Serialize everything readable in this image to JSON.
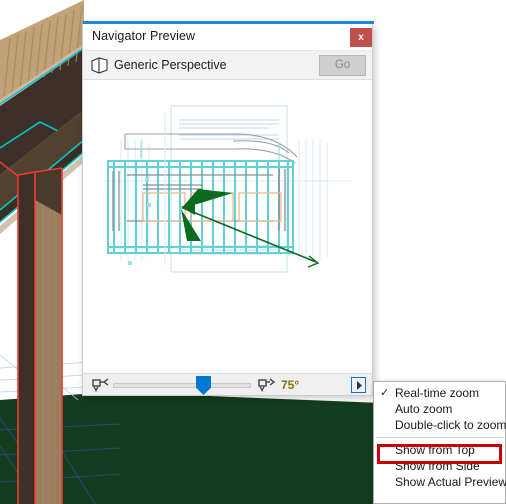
{
  "panel": {
    "title": "Navigator Preview",
    "close_label": "x",
    "close_icon": "close-icon",
    "accent_color": "#1e88d8",
    "close_color": "#c0504b"
  },
  "perspective_row": {
    "icon": "cube-3d-icon",
    "label": "Generic Perspective",
    "go_label": "Go",
    "go_enabled": false
  },
  "toolbar": {
    "zoom_out_icon": "camera-zoom-out-icon",
    "zoom_in_icon": "camera-zoom-in-icon",
    "slider_value": 60,
    "angle_label": "75°",
    "angle_color": "#8a6d13",
    "menu_arrow_icon": "arrow-right-icon"
  },
  "context_menu": {
    "items": [
      {
        "label": "Real-time zoom",
        "checked": true
      },
      {
        "label": "Auto zoom",
        "checked": false
      },
      {
        "label": "Double-click to zoom",
        "checked": false
      },
      {
        "label": "Show from Top",
        "checked": false
      },
      {
        "label": "Show from Side",
        "checked": false
      },
      {
        "label": "Show Actual Preview",
        "checked": false
      }
    ],
    "checkmark": "✓",
    "highlight_color": "#cc0000",
    "highlighted_item": "Show from Top"
  },
  "preview": {
    "description": "floor-plan-preview",
    "camera_cone_color": "#0a6b1e",
    "drawing_color": "#62d0d8",
    "sheet_border_color": "#cfe4f5"
  },
  "viewport": {
    "description": "3d-timber-structure-view",
    "wood_color": "#a98b63",
    "wood_dark_color": "#4a3a2c",
    "edge_color": "#00c8c8",
    "highlight_edge_color": "#f03b2f",
    "ground_color": "#133d1e",
    "sky_color": "#ffffff"
  }
}
